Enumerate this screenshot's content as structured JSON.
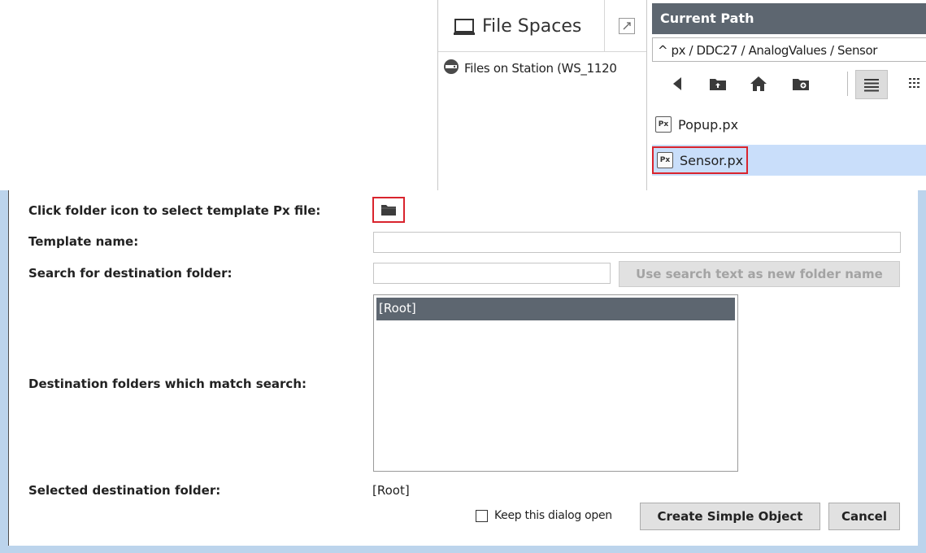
{
  "file_spaces": {
    "title": "File Spaces",
    "items": [
      {
        "label": "Files on Station (WS_1120"
      }
    ]
  },
  "path_panel": {
    "header": "Current Path",
    "path": "^ px / DDC27 / AnalogValues / Sensor",
    "files": [
      {
        "name": "Popup.px",
        "icon": "Px",
        "selected": false
      },
      {
        "name": "Sensor.px",
        "icon": "Px",
        "selected": true
      }
    ]
  },
  "dialog": {
    "labels": {
      "template_file": "Click folder icon to select template Px file:",
      "template_name": "Template name:",
      "search_folder": "Search for destination folder:",
      "matching_folders": "Destination folders which match search:",
      "selected_folder": "Selected destination folder:"
    },
    "template_name_value": "",
    "search_value": "",
    "search_button": "Use search text as new folder name",
    "folders": [
      {
        "label": "[Root]",
        "selected": true
      }
    ],
    "selected_folder_value": "[Root]",
    "keep_open_label": "Keep this dialog open",
    "keep_open_checked": false,
    "create_button": "Create Simple Object",
    "cancel_button": "Cancel"
  },
  "colors": {
    "header_bg": "#5d6670",
    "selection_bg": "#c9defa",
    "highlight_border": "#d9242d",
    "dialog_frame": "#bcd4ec"
  }
}
